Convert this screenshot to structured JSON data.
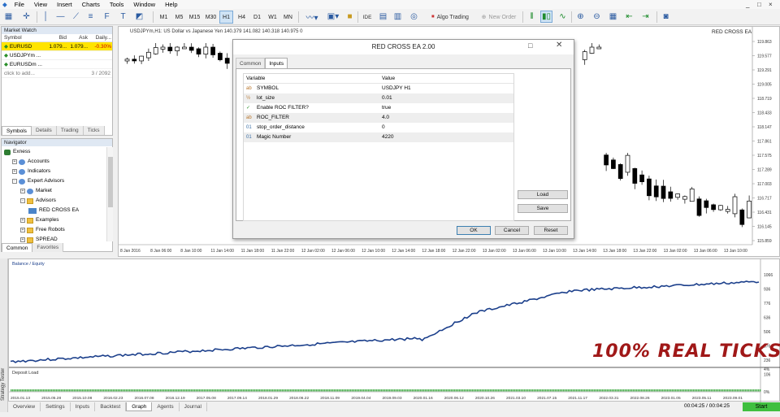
{
  "menu": {
    "items": [
      "File",
      "View",
      "Insert",
      "Charts",
      "Tools",
      "Window",
      "Help"
    ],
    "window_controls": [
      "_",
      "□",
      "×"
    ]
  },
  "toolbar": {
    "timeframes": [
      "M1",
      "M5",
      "M15",
      "M30",
      "H1",
      "H4",
      "D1",
      "W1",
      "MN"
    ],
    "active_timeframe": "H1",
    "ide_label": "IDE",
    "algo_trading_label": "Algo Trading",
    "new_order_label": "New Order"
  },
  "market_watch": {
    "title": "Market Watch",
    "columns": [
      "Symbol",
      "Bid",
      "Ask",
      "Daily..."
    ],
    "rows": [
      {
        "symbol": "EURUSD",
        "bid": "1.079...",
        "ask": "1.079...",
        "daily": "-0.30%",
        "selected": true
      },
      {
        "symbol": "USDJPYm ...",
        "bid": "",
        "ask": "",
        "daily": "",
        "selected": false
      },
      {
        "symbol": "EURUSDm ...",
        "bid": "",
        "ask": "",
        "daily": "",
        "selected": false
      }
    ],
    "add_label": "click to add...",
    "count": "3 / 2092",
    "tabs": [
      "Symbols",
      "Details",
      "Trading",
      "Ticks"
    ]
  },
  "navigator": {
    "title": "Navigator",
    "items": [
      {
        "label": "Exness",
        "level": 0,
        "expander": "",
        "icon": "exness-logo-icon"
      },
      {
        "label": "Accounts",
        "level": 1,
        "expander": "+",
        "icon": "accounts-icon"
      },
      {
        "label": "Indicators",
        "level": 1,
        "expander": "+",
        "icon": "indicators-icon"
      },
      {
        "label": "Expert Advisors",
        "level": 1,
        "expander": "-",
        "icon": "expert-advisors-icon"
      },
      {
        "label": "Market",
        "level": 2,
        "expander": "+",
        "icon": "market-icon"
      },
      {
        "label": "Advisors",
        "level": 2,
        "expander": "-",
        "icon": "folder-icon"
      },
      {
        "label": "RED CROSS EA",
        "level": 3,
        "expander": "",
        "icon": "expert-icon"
      },
      {
        "label": "Examples",
        "level": 2,
        "expander": "+",
        "icon": "folder-icon"
      },
      {
        "label": "Free Robots",
        "level": 2,
        "expander": "+",
        "icon": "folder-icon"
      },
      {
        "label": "SPREAD",
        "level": 2,
        "expander": "+",
        "icon": "folder-icon"
      }
    ],
    "tabs": [
      "Common",
      "Favorites"
    ]
  },
  "chart": {
    "header": "USDJPYm,H1: US Dollar vs Japanese Yen  140.379 141.082 140.318 140.975 0",
    "ea_name": "RED CROSS EA",
    "price_labels": [
      "119.863",
      "119.577",
      "119.291",
      "119.005",
      "118.719",
      "118.433",
      "118.147",
      "117.861",
      "117.575",
      "117.289",
      "117.003",
      "116.717",
      "116.431",
      "116.145",
      "115.859"
    ],
    "time_labels": [
      "8 Jan 2016",
      "8 Jan 06:00",
      "8 Jan 10:00",
      "11 Jan 14:00",
      "11 Jan 18:00",
      "11 Jan 22:00",
      "12 Jan 02:00",
      "12 Jan 06:00",
      "12 Jan 10:00",
      "12 Jan 14:00",
      "12 Jan 18:00",
      "12 Jan 22:00",
      "13 Jan 02:00",
      "13 Jan 06:00",
      "13 Jan 10:00",
      "13 Jan 14:00",
      "13 Jan 18:00",
      "13 Jan 22:00",
      "13 Jan 02:00",
      "13 Jan 06:00",
      "13 Jan 10:00"
    ]
  },
  "dialog": {
    "title": "RED CROSS EA 2.00",
    "tabs": [
      "Common",
      "Inputs"
    ],
    "active_tab": "Inputs",
    "columns": [
      "Variable",
      "Value"
    ],
    "params": [
      {
        "icon": "ab",
        "name": "SYMBOL",
        "value": "USDJPY H1"
      },
      {
        "icon": "½",
        "name": "lot_size",
        "value": "0.01"
      },
      {
        "icon": "✓",
        "name": "Enable ROC FILTER?",
        "value": "true"
      },
      {
        "icon": "ab",
        "name": "ROC_FILTER",
        "value": "4.0"
      },
      {
        "icon": "01",
        "name": "stop_order_distance",
        "value": "0"
      },
      {
        "icon": "01",
        "name": "Magic Number",
        "value": "4220"
      }
    ],
    "load_label": "Load",
    "save_label": "Save",
    "ok_label": "OK",
    "cancel_label": "Cancel",
    "reset_label": "Reset"
  },
  "tester": {
    "legend": "Balance / Equity",
    "deposit_label": "Deposit Load",
    "side_label": "Strategy Tester",
    "overlay": "100% REAL TICKS",
    "y_labels": [
      "1066",
      "936",
      "776",
      "636",
      "506",
      "376",
      "236",
      "106"
    ],
    "zero_label": "0%",
    "pct_label": "4%",
    "date_labels": [
      "2015.01.13",
      "2015.05.28",
      "2015.10.08",
      "2016.02.23",
      "2016.07.08",
      "2016.12.19",
      "2017.05.08",
      "2017.09.14",
      "2018.01.29",
      "2018.06.22",
      "2018.11.09",
      "2019.04.04",
      "2019.09.03",
      "2020.01.16",
      "2020.06.12",
      "2020.10.26",
      "2021.03.10",
      "2021.07.15",
      "2021.11.17",
      "2022.03.31",
      "2022.08.26",
      "2023.01.05",
      "2023.05.11",
      "2023.09.01"
    ],
    "tabs": [
      "Overview",
      "Settings",
      "Inputs",
      "Backtest",
      "Graph",
      "Agents",
      "Journal"
    ],
    "active_tab": "Graph",
    "time_elapsed": "00:04:25",
    "time_total": "00:04:25",
    "start_label": "Start"
  },
  "colors": {
    "equity_line": "#1b3f8b",
    "deposit_bar": "#4caf50",
    "overlay_text": "#a01818",
    "start_button": "#3fbf3f",
    "selected_row": "#ffe400"
  }
}
